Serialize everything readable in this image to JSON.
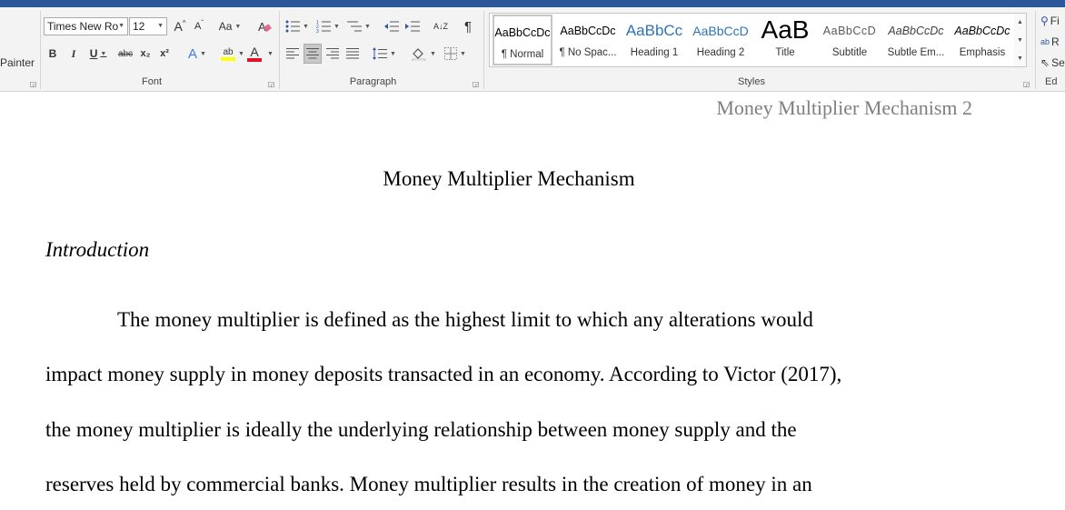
{
  "ribbon": {
    "clipboard": {
      "format_painter_label": "Painter"
    },
    "font": {
      "group_label": "Font",
      "font_name": "Times New Ro",
      "font_size": "12",
      "grow_label": "A",
      "shrink_label": "A",
      "change_case_label": "Aa",
      "bold_label": "B",
      "italic_label": "I",
      "underline_label": "U",
      "strikethrough_label": "abc",
      "subscript_label": "x₂",
      "superscript_label": "x²",
      "text_effects_label": "A",
      "highlight_label": "ab",
      "font_color_label": "A",
      "highlight_color": "#ffff00",
      "font_color": "#e81123"
    },
    "paragraph": {
      "group_label": "Paragraph",
      "sort_label": "A↓Z",
      "pilcrow": "¶"
    },
    "styles": {
      "group_label": "Styles",
      "items": [
        {
          "preview": "AaBbCcDc",
          "name": "¶ Normal"
        },
        {
          "preview": "AaBbCcDc",
          "name": "¶ No Spac..."
        },
        {
          "preview": "AaBbCc",
          "name": "Heading 1"
        },
        {
          "preview": "AaBbCcD",
          "name": "Heading 2"
        },
        {
          "preview": "AaB",
          "name": "Title"
        },
        {
          "preview": "AaBbCcD",
          "name": "Subtitle"
        },
        {
          "preview": "AaBbCcDc",
          "name": "Subtle Em..."
        },
        {
          "preview": "AaBbCcDc",
          "name": "Emphasis"
        }
      ],
      "heading_color": "#2e74b5"
    },
    "editing": {
      "group_label": "Ed",
      "find_label": "Fi",
      "replace_label": "R",
      "select_label": "Se"
    }
  },
  "document": {
    "header_text": "Money Multiplier Mechanism 2",
    "title": "Money Multiplier Mechanism",
    "heading": "Introduction",
    "lines": [
      "The money multiplier is defined as the highest limit to which any alterations would",
      "impact money supply in money deposits transacted in an economy. According to Victor (2017),",
      "the money multiplier is ideally the underlying relationship between money supply and the",
      "reserves held by commercial banks.  Money multiplier results in the creation of money in an"
    ]
  }
}
